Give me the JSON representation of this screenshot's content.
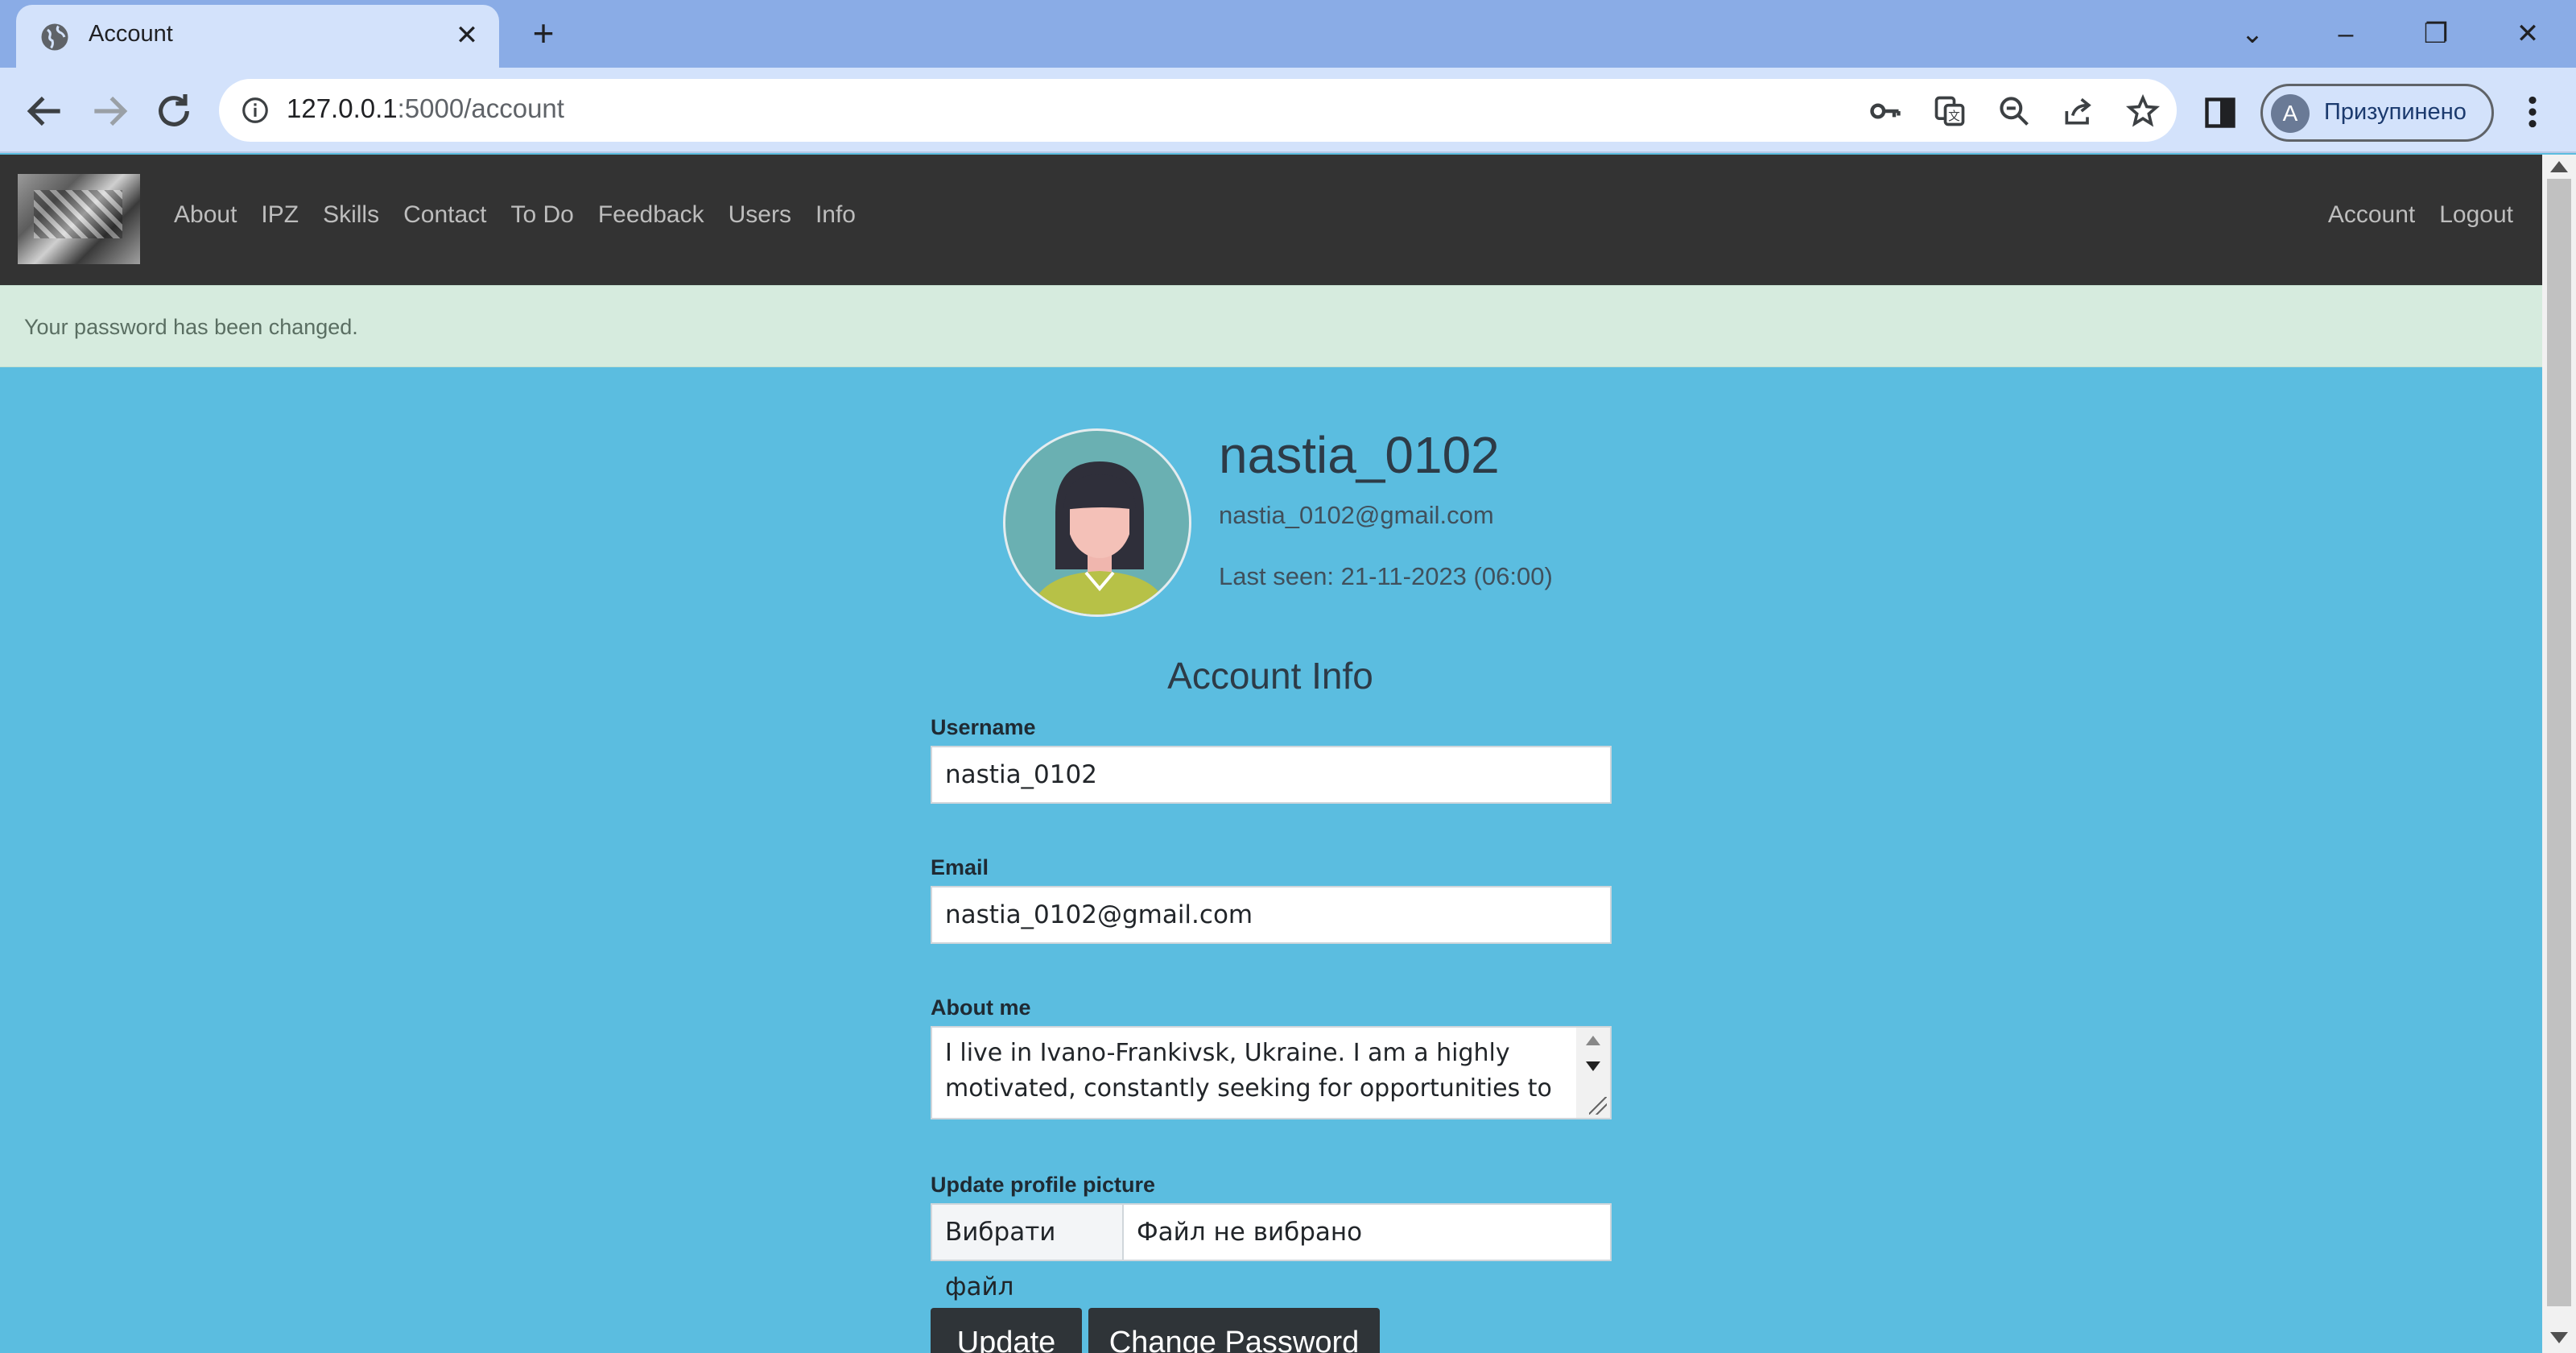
{
  "browser": {
    "tab_title": "Account",
    "url_host": "127.0.0.1",
    "url_rest": ":5000/account",
    "profile_initial": "A",
    "profile_label": "Призупинено"
  },
  "site_nav": {
    "links": [
      "About",
      "IPZ",
      "Skills",
      "Contact",
      "To Do",
      "Feedback",
      "Users",
      "Info"
    ],
    "right_links": [
      "Account",
      "Logout"
    ]
  },
  "alert": {
    "message": "Your password has been changed."
  },
  "profile": {
    "username": "nastia_0102",
    "email": "nastia_0102@gmail.com",
    "last_seen": "Last seen: 21-11-2023 (06:00)"
  },
  "form": {
    "title": "Account Info",
    "username_label": "Username",
    "username_value": "nastia_0102",
    "email_label": "Email",
    "email_value": "nastia_0102@gmail.com",
    "about_label": "About me",
    "about_value": "I live in Ivano-Frankivsk, Ukraine. I am a highly motivated, constantly seeking for opportunities to",
    "picture_label": "Update profile picture",
    "file_button": "Вибрати файл",
    "file_status": "Файл не вибрано",
    "update_button": "Update",
    "change_password_button": "Change Password"
  }
}
